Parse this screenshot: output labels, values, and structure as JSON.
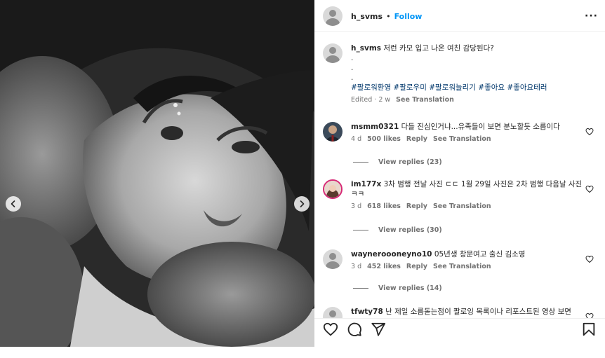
{
  "post": {
    "username": "h_svms",
    "separator": "•",
    "follow_label": "Follow",
    "more_label": "···"
  },
  "caption": {
    "username": "h_svms",
    "text": "저런 카모 입고 나온 여친 감당된다?",
    "lines": [
      ".",
      ".",
      "."
    ],
    "hashtags": "#팔로워환영 #팔로우미 #팔로워늘리기 #좋아요 #좋아요테러",
    "edited": "Edited · 2 w",
    "see_translation": "See Translation"
  },
  "comments": [
    {
      "username": "msmm0321",
      "text": "다들 진심인거냐...유족들이 보면 분노할듯 소름이다",
      "time": "4 d",
      "likes": "500 likes",
      "reply": "Reply",
      "see_translation": "See Translation",
      "view_replies": "View replies (23)"
    },
    {
      "username": "im177x",
      "text": "3차 범행 전날 사진 ㄷㄷ 1월 29일 사진은 2차 범행 다음날 사진 ㅋㅋ",
      "time": "3 d",
      "likes": "618 likes",
      "reply": "Reply",
      "see_translation": "See Translation",
      "view_replies": "View replies (30)"
    },
    {
      "username": "wayneroooneyno10",
      "text": "05년생 창문여고 출신 김소영",
      "time": "3 d",
      "likes": "452 likes",
      "reply": "Reply",
      "see_translation": "See Translation",
      "view_replies": "View replies (14)"
    },
    {
      "username": "tfwty78",
      "text": "난 제일 소름돋는점이 팔로잉 목록이나 리포스트된 영상 보면"
    }
  ],
  "icons": {
    "prev": "chevron-left-icon",
    "next": "chevron-right-icon",
    "like": "heart-icon",
    "comment": "comment-icon",
    "share": "send-icon",
    "save": "bookmark-icon"
  },
  "colors": {
    "link": "#0095f6",
    "hashtag": "#00376b",
    "muted": "#737373"
  }
}
